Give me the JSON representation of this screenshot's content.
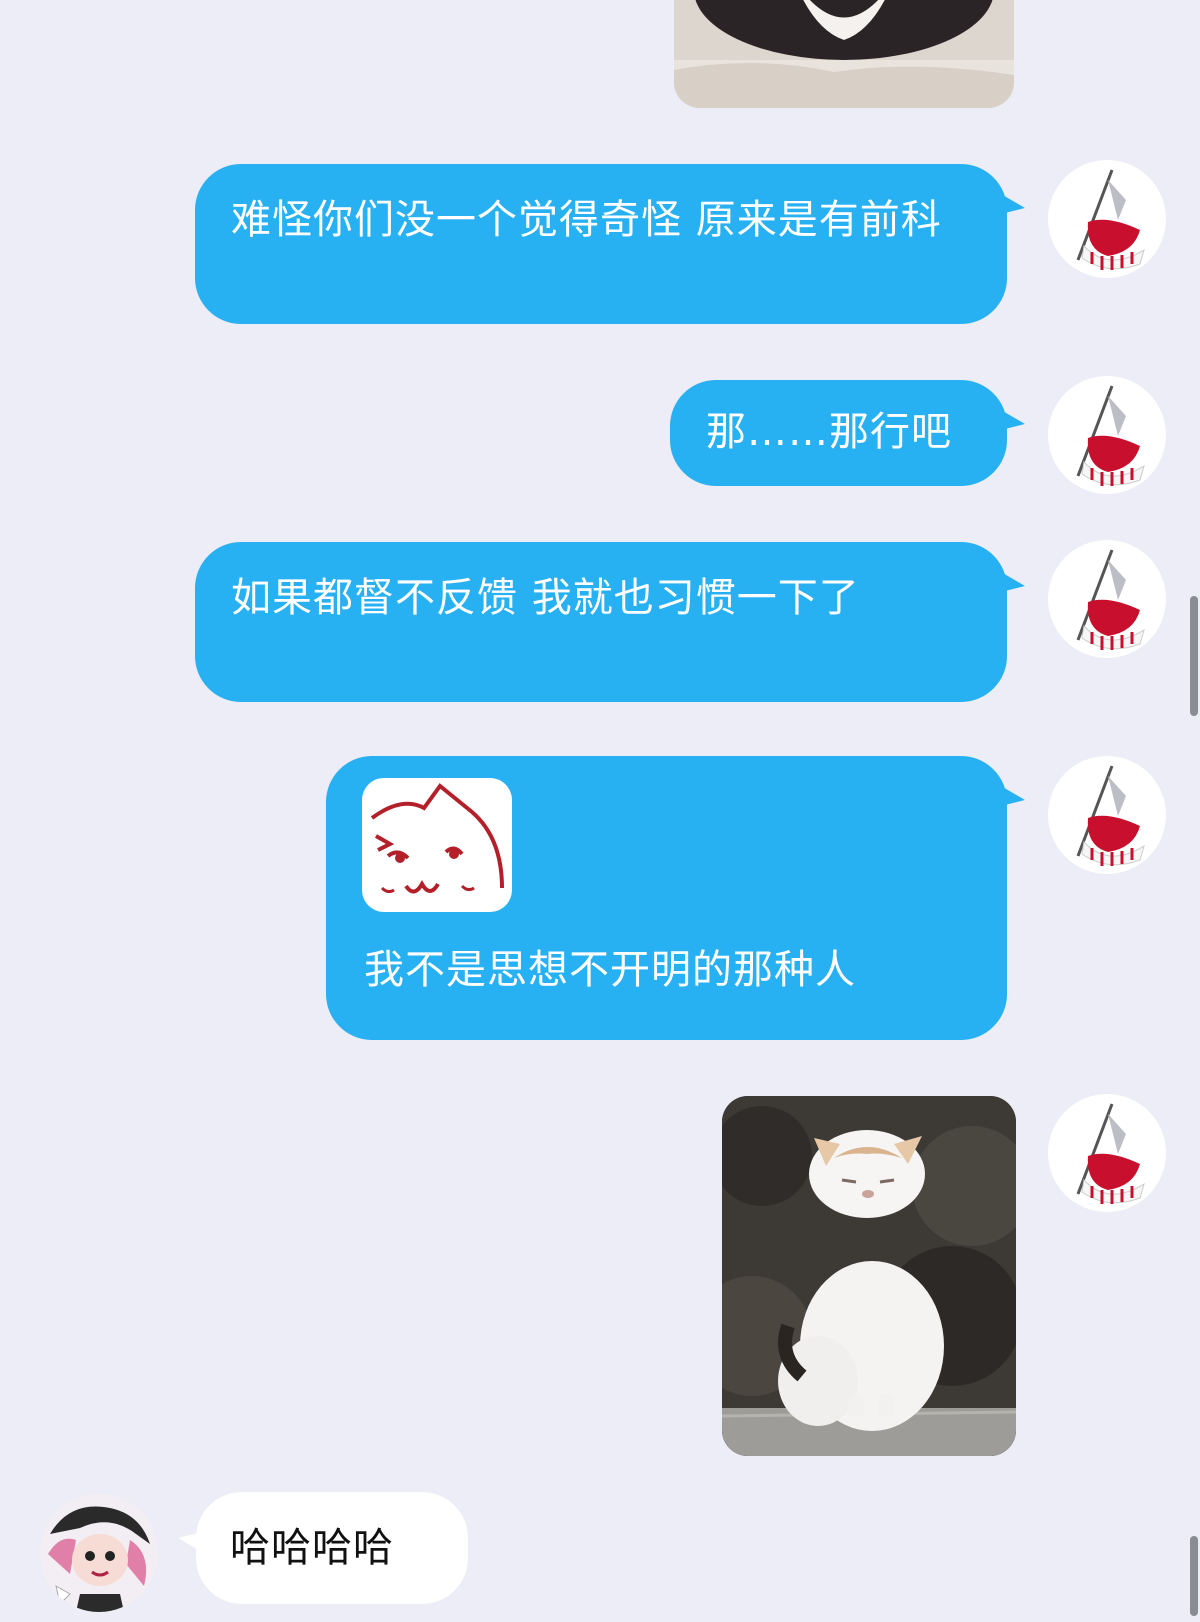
{
  "messages": [
    {
      "id": "m1",
      "side": "out",
      "kind": "image",
      "image": "cat-photo-top"
    },
    {
      "id": "m2",
      "side": "out",
      "kind": "text",
      "text": "难怪你们没一个觉得奇怪 原来是有前科"
    },
    {
      "id": "m3",
      "side": "out",
      "kind": "text",
      "text": "那……那行吧"
    },
    {
      "id": "m4",
      "side": "out",
      "kind": "text",
      "text": "如果都督不反馈 我就也习惯一下了"
    },
    {
      "id": "m5",
      "side": "out",
      "kind": "sticker-text",
      "sticker": "smug-cat-sticker",
      "text": "我不是思想不开明的那种人"
    },
    {
      "id": "m6",
      "side": "out",
      "kind": "image",
      "image": "white-cat-standing-photo"
    },
    {
      "id": "m7",
      "side": "in",
      "kind": "text",
      "text": "哈哈哈哈"
    }
  ],
  "colors": {
    "background": "#ecedf6",
    "outgoing_bubble": "#27b0f2",
    "incoming_bubble": "#ffffff",
    "avatar_red": "#c8102e"
  },
  "icons": {
    "outgoing_avatar": "red-white-emblem-avatar",
    "incoming_avatar": "cartoon-character-avatar"
  }
}
